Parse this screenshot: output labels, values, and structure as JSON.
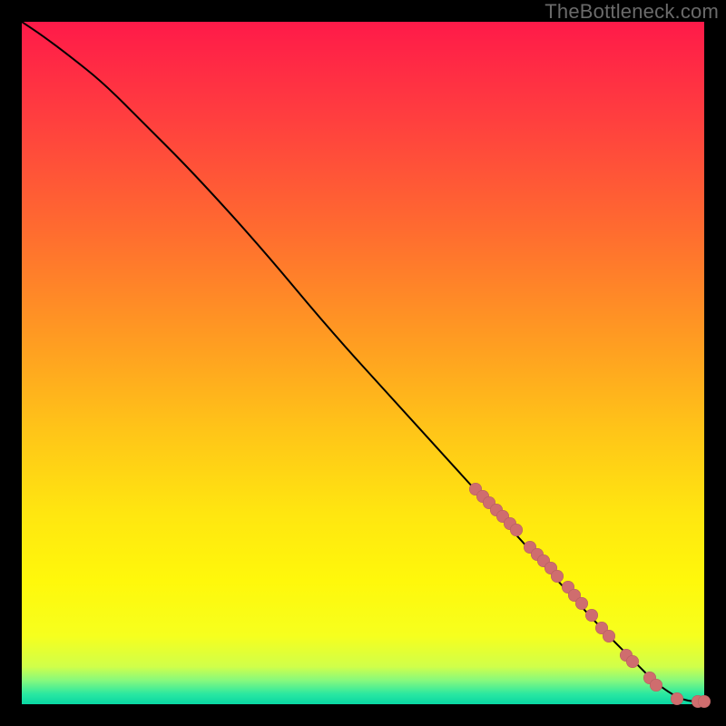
{
  "watermark": "TheBottleneck.com",
  "colors": {
    "dot": "#cf6d6e",
    "curve": "#000000",
    "gradient_stops": [
      {
        "pos": 0.0,
        "color": "#ff1a49"
      },
      {
        "pos": 0.14,
        "color": "#ff3e3f"
      },
      {
        "pos": 0.3,
        "color": "#ff6a30"
      },
      {
        "pos": 0.46,
        "color": "#ff9a22"
      },
      {
        "pos": 0.6,
        "color": "#ffc518"
      },
      {
        "pos": 0.72,
        "color": "#ffe610"
      },
      {
        "pos": 0.82,
        "color": "#fff80b"
      },
      {
        "pos": 0.9,
        "color": "#f6ff1e"
      },
      {
        "pos": 0.945,
        "color": "#d0ff4a"
      },
      {
        "pos": 0.965,
        "color": "#87f97d"
      },
      {
        "pos": 0.985,
        "color": "#2ae8a1"
      },
      {
        "pos": 1.0,
        "color": "#09d6a3"
      }
    ]
  },
  "chart_data": {
    "type": "line",
    "title": "",
    "xlabel": "",
    "ylabel": "",
    "xlim": [
      0,
      100
    ],
    "ylim": [
      0,
      100
    ],
    "series": [
      {
        "name": "curve",
        "x": [
          0,
          3,
          7,
          12,
          18,
          25,
          35,
          45,
          55,
          65,
          75,
          85,
          90,
          93,
          96,
          98,
          100
        ],
        "y": [
          100,
          98,
          95,
          91,
          85,
          78,
          67,
          55,
          44,
          33,
          22,
          11,
          6,
          3,
          1,
          0.4,
          0.4
        ]
      }
    ],
    "dots": {
      "name": "markers",
      "points": [
        {
          "x": 66.5,
          "y": 31.5
        },
        {
          "x": 67.5,
          "y": 30.5
        },
        {
          "x": 68.5,
          "y": 29.5
        },
        {
          "x": 69.5,
          "y": 28.5
        },
        {
          "x": 70.5,
          "y": 27.5
        },
        {
          "x": 71.5,
          "y": 26.5
        },
        {
          "x": 72.5,
          "y": 25.5
        },
        {
          "x": 74.5,
          "y": 23.0
        },
        {
          "x": 75.5,
          "y": 22.0
        },
        {
          "x": 76.5,
          "y": 21.0
        },
        {
          "x": 77.5,
          "y": 20.0
        },
        {
          "x": 78.5,
          "y": 18.8
        },
        {
          "x": 80.0,
          "y": 17.2
        },
        {
          "x": 81.0,
          "y": 16.0
        },
        {
          "x": 82.0,
          "y": 14.8
        },
        {
          "x": 83.5,
          "y": 13.0
        },
        {
          "x": 85.0,
          "y": 11.2
        },
        {
          "x": 86.0,
          "y": 10.0
        },
        {
          "x": 88.5,
          "y": 7.2
        },
        {
          "x": 89.5,
          "y": 6.2
        },
        {
          "x": 92.0,
          "y": 3.8
        },
        {
          "x": 93.0,
          "y": 2.8
        },
        {
          "x": 96.0,
          "y": 0.8
        },
        {
          "x": 99.0,
          "y": 0.4
        },
        {
          "x": 100.0,
          "y": 0.4
        }
      ]
    }
  }
}
